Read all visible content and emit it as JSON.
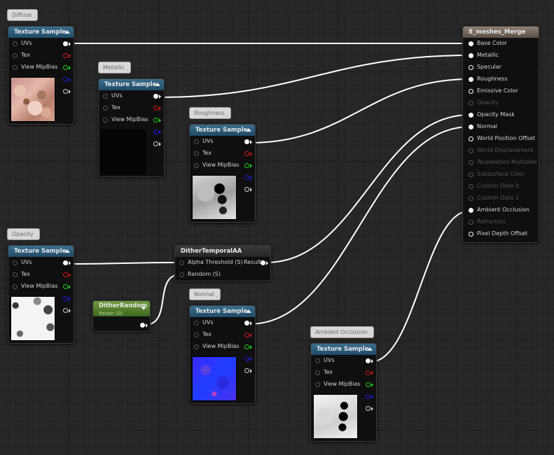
{
  "comments": {
    "diffuse": "Diffuse",
    "metallic": "Metallic",
    "roughness": "Roughness",
    "opacity": "Opacity",
    "normal": "Normal",
    "ambient_occlusion": "Ambient Occlusion"
  },
  "texture_sample": {
    "title": "Texture Sample",
    "pins": [
      "UVs",
      "Tex",
      "View MipBias"
    ]
  },
  "merge_node": {
    "title": "8_meshes_Merge",
    "inputs": [
      {
        "label": "Base Color",
        "active": true
      },
      {
        "label": "Metallic",
        "active": true
      },
      {
        "label": "Specular",
        "active": true
      },
      {
        "label": "Roughness",
        "active": true
      },
      {
        "label": "Emissive Color",
        "active": true
      },
      {
        "label": "Opacity",
        "active": false
      },
      {
        "label": "Opacity Mask",
        "active": true
      },
      {
        "label": "Normal",
        "active": true
      },
      {
        "label": "World Position Offset",
        "active": true
      },
      {
        "label": "World Displacement",
        "active": false
      },
      {
        "label": "Tessellation Multiplier",
        "active": false
      },
      {
        "label": "Subsurface Color",
        "active": false
      },
      {
        "label": "Custom Data 0",
        "active": false
      },
      {
        "label": "Custom Data 1",
        "active": false
      },
      {
        "label": "Ambient Occlusion",
        "active": true
      },
      {
        "label": "Refraction",
        "active": false
      },
      {
        "label": "Pixel Depth Offset",
        "active": true
      }
    ]
  },
  "dither_node": {
    "title": "DitherTemporalAA",
    "input_alpha": "Alpha Threshold (S)",
    "input_random": "Random (S)",
    "output": "Result"
  },
  "param_node": {
    "title": "DitherRandom",
    "subtitle": "Param (0)"
  },
  "colors": {
    "texture_header": "#2c5a78",
    "merge_header": "#7a6c62",
    "param_header": "#5a8a30",
    "wire": "#ffffff",
    "pin_red": "#d21515",
    "pin_green": "#1cd41c",
    "pin_blue": "#1b1bd8"
  }
}
